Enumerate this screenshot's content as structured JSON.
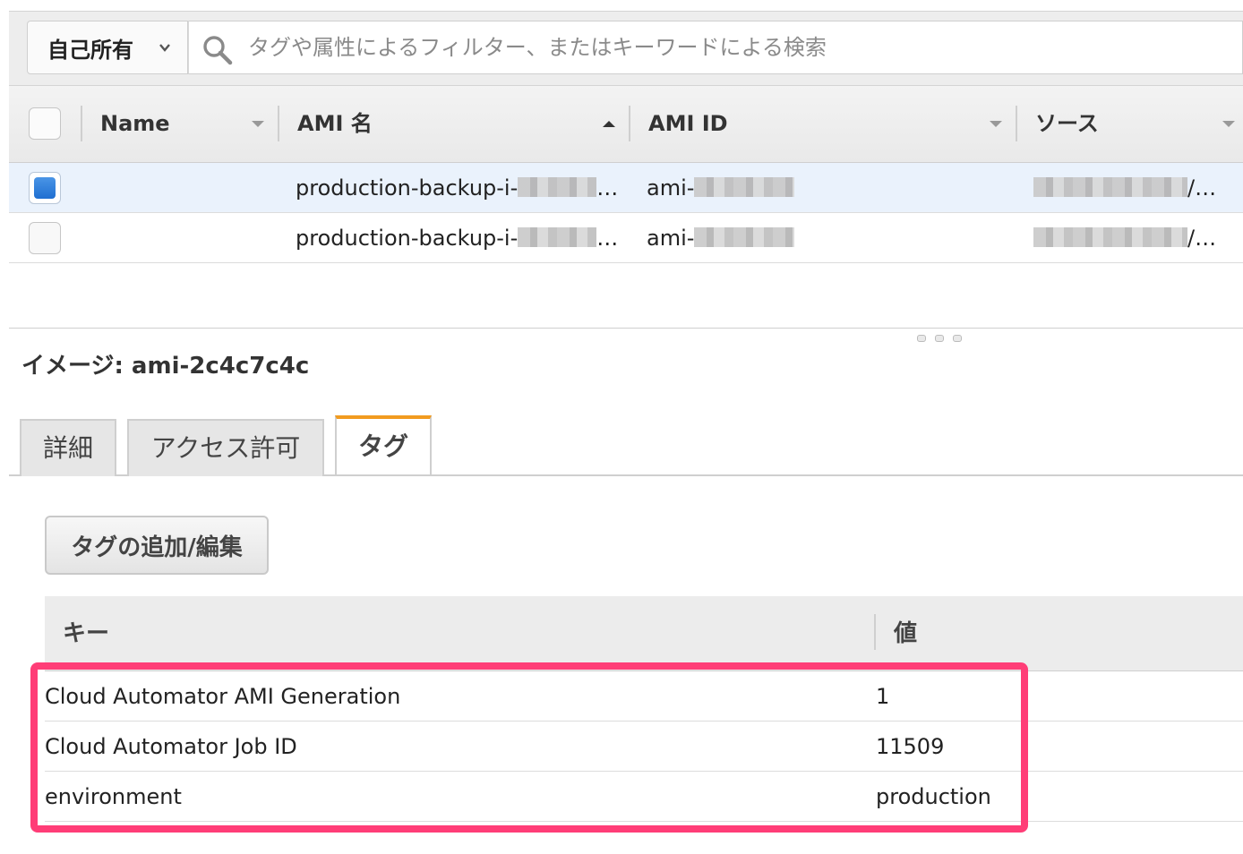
{
  "filter": {
    "owner_select": "自己所有",
    "search_placeholder": "タグや属性によるフィルター、またはキーワードによる検索"
  },
  "table": {
    "columns": [
      "Name",
      "AMI 名",
      "AMI ID",
      "ソース"
    ],
    "rows": [
      {
        "selected": true,
        "name": "",
        "ami_name": "production-backup-i-",
        "ami_id": "ami-",
        "source_suffix": "/…"
      },
      {
        "selected": false,
        "name": "",
        "ami_name": "production-backup-i-",
        "ami_id": "ami-",
        "source_suffix": "/…"
      }
    ],
    "ellipsis": "…"
  },
  "details": {
    "title": "イメージ: ami-2c4c7c4c",
    "tabs": [
      "詳細",
      "アクセス許可",
      "タグ"
    ],
    "active_tab": "タグ",
    "add_edit_button": "タグの追加/編集",
    "tag_columns": [
      "キー",
      "値"
    ],
    "tags": [
      {
        "key": "Cloud Automator AMI Generation",
        "value": "1"
      },
      {
        "key": "Cloud Automator Job ID",
        "value": "11509"
      },
      {
        "key": "environment",
        "value": "production"
      }
    ]
  },
  "colors": {
    "highlight": "#ff3d77",
    "active_tab_accent": "#f29b1f",
    "checkbox_checked": "#1f6fd1",
    "selected_row": "#eaf2fc"
  }
}
